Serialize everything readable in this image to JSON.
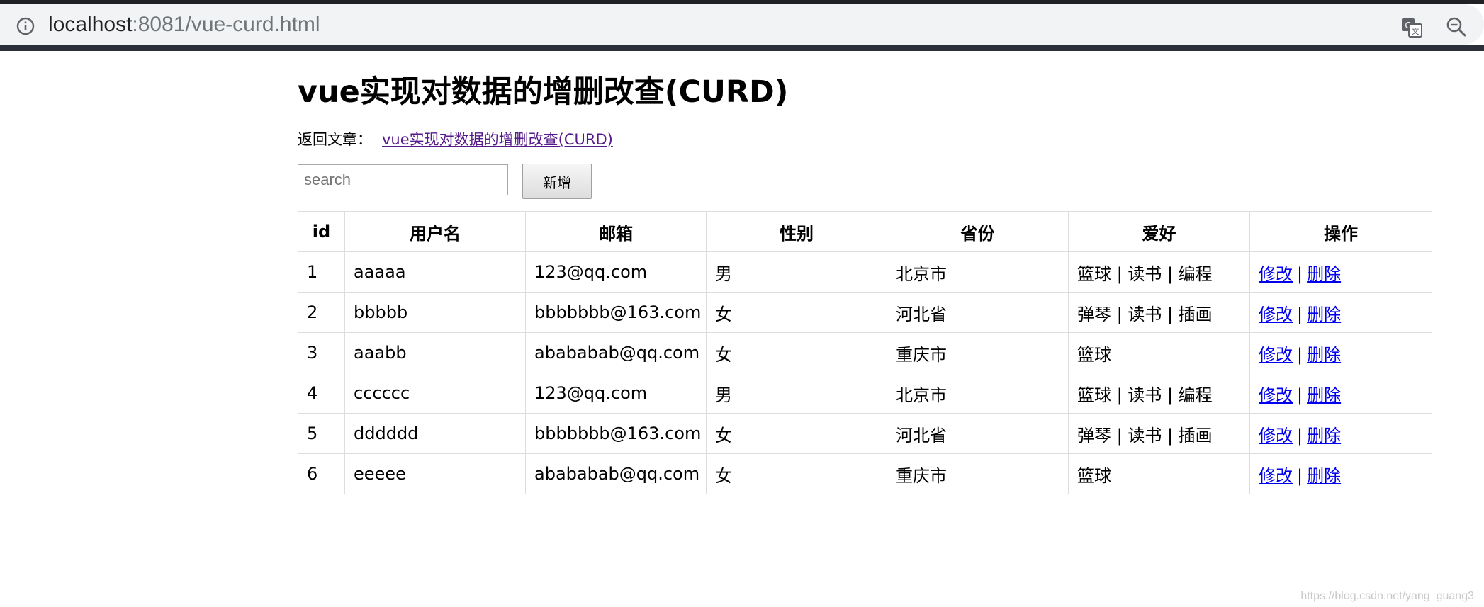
{
  "browser": {
    "url_host": "localhost",
    "url_rest": ":8081/vue-curd.html"
  },
  "page": {
    "title": "vue实现对数据的增删改查(CURD)",
    "back_label": "返回文章：",
    "back_link_text": "vue实现对数据的增删改查(CURD)"
  },
  "toolbar": {
    "search_placeholder": "search",
    "search_value": "",
    "add_label": "新增"
  },
  "table": {
    "headers": [
      "id",
      "用户名",
      "邮箱",
      "性别",
      "省份",
      "爱好",
      "操作"
    ],
    "edit_label": "修改",
    "delete_label": "删除",
    "op_separator": "|",
    "rows": [
      {
        "id": "1",
        "username": "aaaaa",
        "email": "123@qq.com",
        "gender": "男",
        "province": "北京市",
        "hobbies": "篮球 | 读书 | 编程"
      },
      {
        "id": "2",
        "username": "bbbbb",
        "email": "bbbbbbb@163.com",
        "gender": "女",
        "province": "河北省",
        "hobbies": "弹琴 | 读书 | 插画"
      },
      {
        "id": "3",
        "username": "aaabb",
        "email": "abababab@qq.com",
        "gender": "女",
        "province": "重庆市",
        "hobbies": "篮球"
      },
      {
        "id": "4",
        "username": "cccccc",
        "email": "123@qq.com",
        "gender": "男",
        "province": "北京市",
        "hobbies": "篮球 | 读书 | 编程"
      },
      {
        "id": "5",
        "username": "dddddd",
        "email": "bbbbbbb@163.com",
        "gender": "女",
        "province": "河北省",
        "hobbies": "弹琴 | 读书 | 插画"
      },
      {
        "id": "6",
        "username": "eeeee",
        "email": "abababab@qq.com",
        "gender": "女",
        "province": "重庆市",
        "hobbies": "篮球"
      }
    ]
  },
  "watermark": "https://blog.csdn.net/yang_guang3",
  "icons": {
    "info": "info-icon",
    "translate": "translate-icon",
    "zoom": "zoom-out-icon"
  }
}
